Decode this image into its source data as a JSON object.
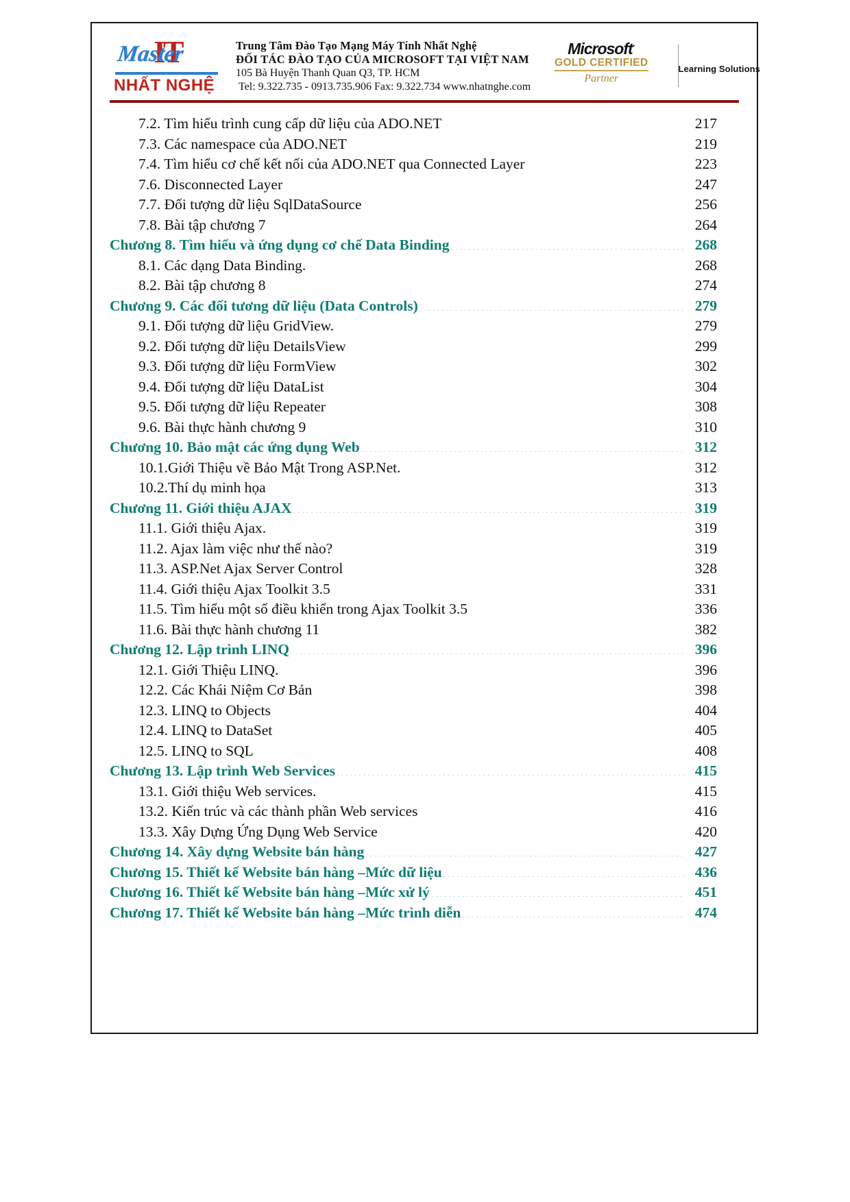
{
  "header": {
    "logo": {
      "it": "IT",
      "master": "Master",
      "brand": "NHẤT NGHỆ"
    },
    "address": {
      "line1": "Trung Tâm Đào Tạo Mạng Máy Tính Nhất Nghệ",
      "line2": "ĐỐI TÁC ĐÀO TẠO CỦA MICROSOFT TẠI VIỆT NAM",
      "line3": "105 Bà Huyện Thanh Quan  Q3, TP. HCM",
      "line4": "Tel: 9.322.735 - 0913.735.906 Fax: 9.322.734 www.nhatnghe.com"
    },
    "microsoft": {
      "brand": "Microsoft",
      "level": "GOLD CERTIFIED",
      "partner": "Partner",
      "learning": "Learning Solutions"
    },
    "rule_color": "#8a1410"
  },
  "toc": {
    "chapter_color": "#0e7c72",
    "entry_color": "#111111",
    "entries": [
      {
        "level": 2,
        "label": "7.2. Tìm hiểu trình cung cấp dữ liệu của ADO.NET",
        "page": "217"
      },
      {
        "level": 2,
        "label": "7.3. Các namespace của ADO.NET",
        "page": "219"
      },
      {
        "level": 2,
        "label": "7.4. Tìm hiểu cơ chế kết nối của ADO.NET qua Connected Layer",
        "page": "223"
      },
      {
        "level": 2,
        "label": "7.6. Disconnected Layer",
        "page": "247"
      },
      {
        "level": 2,
        "label": "7.7. Đối tượng dữ liệu SqlDataSource",
        "page": "256"
      },
      {
        "level": 2,
        "label": "7.8. Bài tập chương 7",
        "page": "264"
      },
      {
        "level": 1,
        "label": "Chương 8. Tìm hiểu và ứng dụng cơ chế Data Binding",
        "page": "268"
      },
      {
        "level": 2,
        "label": "8.1. Các dạng Data Binding.",
        "page": "268"
      },
      {
        "level": 2,
        "label": "8.2. Bài tập chương 8",
        "page": "274"
      },
      {
        "level": 1,
        "label": "Chương 9. Các đối tương dữ liệu (Data Controls)",
        "page": "279"
      },
      {
        "level": 2,
        "label": "9.1. Đối tượng dữ liệu GridView.",
        "page": "279"
      },
      {
        "level": 2,
        "label": "9.2. Đối tượng dữ liệu DetailsView",
        "page": "299"
      },
      {
        "level": 2,
        "label": "9.3. Đối tượng dữ liệu FormView",
        "page": "302"
      },
      {
        "level": 2,
        "label": "9.4. Đối tượng dữ liệu DataList",
        "page": "304"
      },
      {
        "level": 2,
        "label": "9.5. Đối tượng dữ liệu Repeater",
        "page": "308"
      },
      {
        "level": 2,
        "label": "9.6. Bài thực hành chương 9",
        "page": "310"
      },
      {
        "level": 1,
        "label": "Chương 10. Bảo mật các ứng dụng Web",
        "page": "312"
      },
      {
        "level": 2,
        "label": "10.1.Giới Thiệu về Bảo Mật Trong ASP.Net.",
        "page": "312"
      },
      {
        "level": 2,
        "label": "10.2.Thí dụ minh họa",
        "page": "313"
      },
      {
        "level": 1,
        "label": "Chương 11.  Giới thiệu AJAX",
        "page": "319"
      },
      {
        "level": 2,
        "label": "11.1.  Giới thiệu Ajax.",
        "page": "319"
      },
      {
        "level": 2,
        "label": "11.2.  Ajax làm việc như thế nào?",
        "page": "319"
      },
      {
        "level": 2,
        "label": "11.3.  ASP.Net Ajax Server Control",
        "page": "328"
      },
      {
        "level": 2,
        "label": "11.4.  Giới thiệu Ajax Toolkit 3.5",
        "page": "331"
      },
      {
        "level": 2,
        "label": "11.5.  Tìm hiểu một số điều khiển trong Ajax Toolkit 3.5",
        "page": "336"
      },
      {
        "level": 2,
        "label": "11.6.  Bài thực hành chương 11",
        "page": "382"
      },
      {
        "level": 1,
        "label": "Chương 12. Lập trình LINQ",
        "page": "396"
      },
      {
        "level": 2,
        "label": "12.1.  Giới Thiệu LINQ.",
        "page": "396"
      },
      {
        "level": 2,
        "label": "12.2.  Các Khái Niệm Cơ Bản",
        "page": "398"
      },
      {
        "level": 2,
        "label": "12.3.  LINQ to Objects",
        "page": "404"
      },
      {
        "level": 2,
        "label": "12.4.  LINQ to DataSet",
        "page": "405"
      },
      {
        "level": 2,
        "label": "12.5.  LINQ to SQL",
        "page": "408"
      },
      {
        "level": 1,
        "label": "Chương 13.  Lập trình Web Services",
        "page": "415"
      },
      {
        "level": 2,
        "label": "13.1.  Giới thiệu Web services.",
        "page": "415"
      },
      {
        "level": 2,
        "label": "13.2.  Kiến trúc và các thành phần Web services",
        "page": "416"
      },
      {
        "level": 2,
        "label": "13.3.  Xây Dựng Ứng Dụng Web Service",
        "page": "420"
      },
      {
        "level": 1,
        "label": "Chương 14. Xây dựng Website bán hàng",
        "page": "427"
      },
      {
        "level": 1,
        "label": "Chương 15. Thiết kế Website bán hàng –Mức dữ liệu",
        "page": "436"
      },
      {
        "level": 1,
        "label": "Chương 16. Thiết kế Website bán hàng –Mức xử lý",
        "page": "451"
      },
      {
        "level": 1,
        "label": "Chương 17. Thiết kế Website bán hàng –Mức trình diễn",
        "page": "474"
      }
    ]
  }
}
